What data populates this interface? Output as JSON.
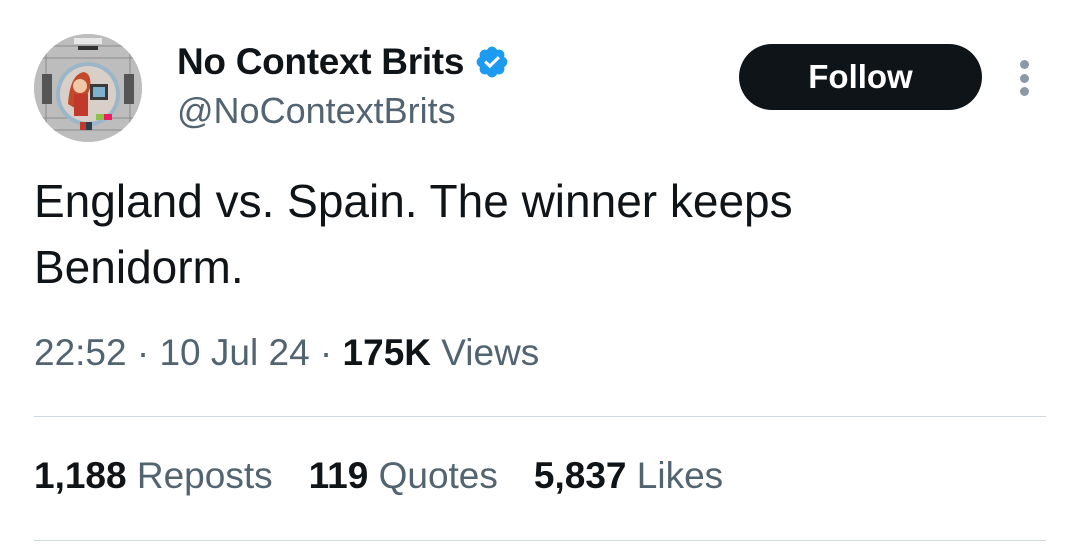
{
  "author": {
    "display_name": "No Context Brits",
    "handle": "@NoContextBrits",
    "verified_icon": "verified-badge-icon",
    "avatar_icon": "test-card-avatar"
  },
  "actions": {
    "follow_label": "Follow",
    "more_icon": "more-vertical-icon"
  },
  "tweet": {
    "text": "England vs. Spain. The winner keeps\nBenidorm."
  },
  "meta": {
    "time": "22:52",
    "separator": " · ",
    "date": "10 Jul 24",
    "views_count": "175K",
    "views_label": "Views"
  },
  "stats": {
    "reposts_count": "1,188",
    "reposts_label": "Reposts",
    "quotes_count": "119",
    "quotes_label": "Quotes",
    "likes_count": "5,837",
    "likes_label": "Likes"
  },
  "colors": {
    "text_primary": "#0f1419",
    "text_secondary": "#536471",
    "verified_blue": "#1d9bf0",
    "follow_bg": "#0f1419",
    "divider": "#cfd9de"
  }
}
